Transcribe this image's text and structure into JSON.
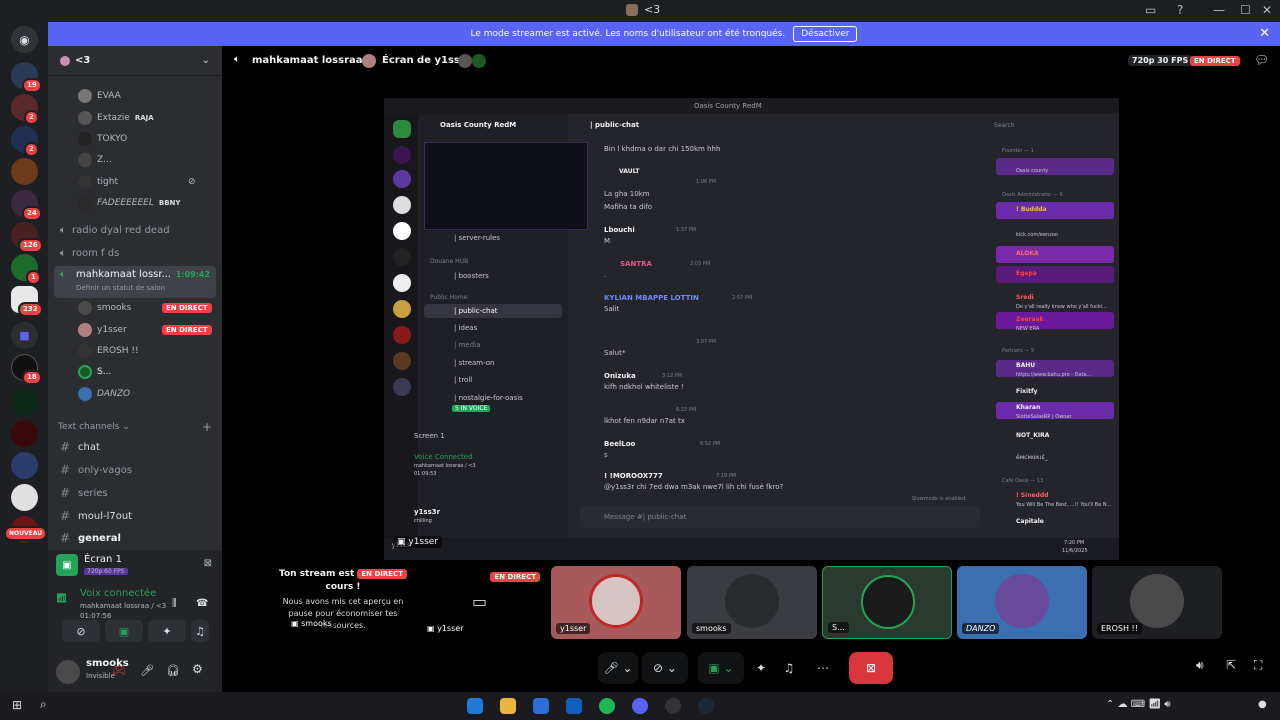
{
  "window": {
    "title": "<3"
  },
  "notice": {
    "text": "Le mode streamer est activé. Les noms d'utilisateur ont été tronqués.",
    "button": "Désactiver"
  },
  "rail": {
    "badges": [
      "19",
      "2",
      "2",
      "24",
      "126",
      "1",
      "232",
      "18"
    ],
    "new_label": "NOUVEAU"
  },
  "server": {
    "name": "<3"
  },
  "channels": {
    "voice_users_top": [
      {
        "name": "EVAA"
      },
      {
        "name": "Extazie",
        "tag": "RAJA"
      },
      {
        "name": "TOKYO"
      },
      {
        "name": "Z..."
      },
      {
        "name": "tight"
      },
      {
        "name": "FADEEEEEEL",
        "tag": "BBNY"
      }
    ],
    "voice_channels": [
      {
        "name": "radio dyal red dead"
      },
      {
        "name": "room f ds"
      }
    ],
    "active_channel": {
      "name": "mahkamaat lossr...",
      "timer": "1:09:42",
      "status": "Définir un statut de salon"
    },
    "active_users": [
      {
        "name": "smooks",
        "live": "EN DIRECT"
      },
      {
        "name": "y1sser",
        "live": "EN DIRECT"
      },
      {
        "name": "EROSH !!"
      },
      {
        "name": "S..."
      },
      {
        "name": "DANZO"
      }
    ],
    "text_header": "Text channels",
    "text_channels": [
      "chat",
      "only-vagos",
      "series",
      "moul-l7out",
      "general"
    ]
  },
  "screen_panel": {
    "title": "Écran 1",
    "quality": "720p 60 FPS"
  },
  "voice": {
    "status": "Voix connectée",
    "location": "mahkamaat lossraa / <3",
    "time": "01:07:56"
  },
  "user": {
    "name": "smooks",
    "status": "Invisible"
  },
  "stage": {
    "channel": "mahkamaat lossraa",
    "screen_title": "Écran de y1sser",
    "quality": "720p 30 FPS",
    "live": "EN DIRECT",
    "stream_notice_title": "Ton stream est",
    "stream_notice_live": "EN DIRECT",
    "stream_notice_title2": "cours !",
    "stream_notice_body": "Nous avons mis cet aperçu en pause pour économiser tes ressources.",
    "tiles": [
      {
        "name": "y1sser",
        "live": "EN DIRECT",
        "color": "#000000"
      },
      {
        "name": "y1sser",
        "color": "#a85a5a"
      },
      {
        "name": "smooks",
        "color": "#3a3c42"
      },
      {
        "name": "S...",
        "color": "#2b5a2f"
      },
      {
        "name": "DANZO",
        "color": "#3b6fb0"
      },
      {
        "name": "EROSH !!",
        "color": "#1e1f22"
      }
    ],
    "overlay_label": "y1sser",
    "overlay_user": "smooks"
  },
  "inner": {
    "window_title": "Oasis County RedM",
    "server": "Oasis County RedM",
    "channel": "| public-chat",
    "search": "Search",
    "categories": [
      "Douane HUB",
      "Public Home"
    ],
    "channels": [
      "| server-rules",
      "| boosters",
      "| public-chat",
      "| ideas",
      "| media",
      "| stream-on",
      "| troll",
      "| nostalgie-for-oasis"
    ],
    "in_voice": "5 IN VOICE",
    "screen": "Screen 1",
    "voice_status": "Voice Connected",
    "voice_loc": "mahkamaat lossraa / <3",
    "voice_time": "01:09:53",
    "user": "y1ss3r",
    "user_status": "chilling",
    "messages": [
      {
        "name": "",
        "time": "",
        "text": "Bin l khdma o dar chi 150km hhh"
      },
      {
        "name": "VAULT",
        "time": "1:06 PM",
        "text": "La gha 10km"
      },
      {
        "name": "",
        "time": "",
        "text": "Mafiha ta difo"
      },
      {
        "name": "Lbouchi",
        "time": "1:37 PM",
        "text": "M"
      },
      {
        "name": "SANTRA",
        "time": "2:03 PM",
        "text": "."
      },
      {
        "name": "KYLIAN MBAPPE LOTTIN",
        "time": "2:57 PM",
        "text": "Salit"
      },
      {
        "name": "",
        "time": "3:07 PM",
        "text": "Salut*"
      },
      {
        "name": "Onizuka",
        "time": "3:12 PM",
        "text": "kifh ndkhol whiteliste !"
      },
      {
        "name": "",
        "time": "6:22 PM",
        "text": "lkhot fen n9dar n7at tx"
      },
      {
        "name": "BeelLoo",
        "time": "6:52 PM",
        "text": "s"
      },
      {
        "name": "! !MOROOX777",
        "time": "7:19 PM",
        "text": "@y1ss3r chi 7ed dwa m3ak nwe7l lih chi fusé fkro?"
      }
    ],
    "slowmode": "Slowmode is enabled.",
    "input_placeholder": "Message #| public-chat",
    "groups": [
      "Founder — 1",
      "Oasis Administrator — 6",
      "Partners — 5",
      "Cafe Oasis — 13"
    ],
    "members": [
      "Oasis county",
      "! Buddda",
      "kick.com/eenzoo",
      "ALOKA",
      "Egepa",
      "Sredi",
      "Do y'all really know who y'all fucki...",
      "Zeeraak",
      "NEW ERA",
      "BAHU",
      "https://www.bahu.pro - Data...",
      "Fixitfy",
      "Kharan",
      "SlotteSalasRP | Owner",
      "NOT_KIRA",
      "éмсмακιέ_",
      "! Sineddd",
      "You Will Be The Best, ...!! You'll Be N...",
      "Capitale"
    ],
    "clock": "7:20 PM",
    "date": "11/6/2025",
    "preview_label": "y1ss3r"
  },
  "colors": {
    "accent": "#5865f2",
    "live": "#ed4245",
    "green": "#23a559"
  }
}
